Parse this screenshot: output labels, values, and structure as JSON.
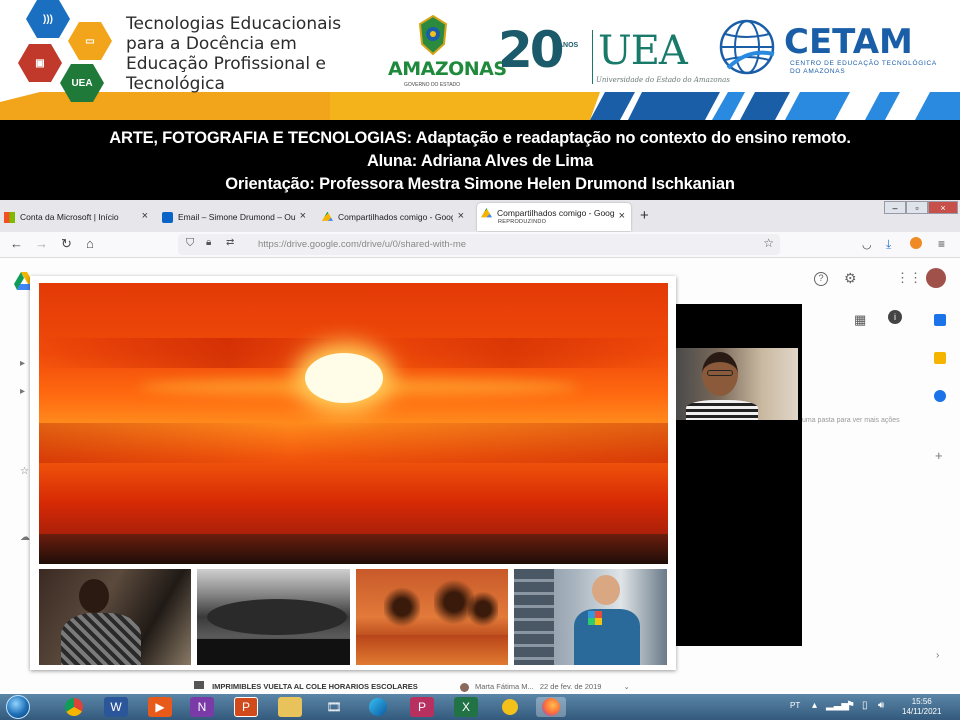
{
  "banner": {
    "title_lines": [
      "Tecnologias Educacionais",
      "para a Docência em",
      "Educação Profissional e",
      "Tecnológica"
    ],
    "uea_badge": "UEA",
    "amazonas": "AMAZONAS",
    "amazonas_sub": "GOVERNO DO ESTADO",
    "uea_years": "20",
    "uea_anos": "ANOS",
    "uea_name": "UEA",
    "uea_signature": "Universidade do Estado do Amazonas",
    "cetam": "CETAM",
    "cetam_sub": "CENTRO DE EDUCAÇÃO TECNOLÓGICA DO AMAZONAS"
  },
  "title_band": {
    "line1": "ARTE, FOTOGRAFIA E TECNOLOGIAS: Adaptação e readaptação no contexto do ensino remoto.",
    "line2": "Aluna: Adriana Alves de Lima",
    "line3": "Orientação: Professora Mestra Simone Helen Drumond Ischkanian"
  },
  "browser": {
    "tabs": [
      {
        "label": "Conta da Microsoft | Início",
        "icon": "microsoft-icon"
      },
      {
        "label": "Email – Simone Drumond – Outl",
        "icon": "outlook-icon"
      },
      {
        "label": "Compartilhados comigo - Goog",
        "icon": "drive-icon"
      },
      {
        "label": "Compartilhados comigo - Goog",
        "sub": "REPRODUZINDO",
        "icon": "drive-icon"
      }
    ],
    "new_tab": "+",
    "url": "https://drive.google.com/drive/u/0/shared-with-me"
  },
  "drive": {
    "hint": "uma pasta para ver mais ações",
    "row_text": "IMPRIMIBLES VUELTA AL COLE HORARIOS ESCOLARES",
    "row_owner": "Marta Fátima M...",
    "row_date": "22 de fev. de 2019"
  },
  "taskbar": {
    "lang": "PT",
    "time": "15:56",
    "date": "14/11/2021"
  }
}
